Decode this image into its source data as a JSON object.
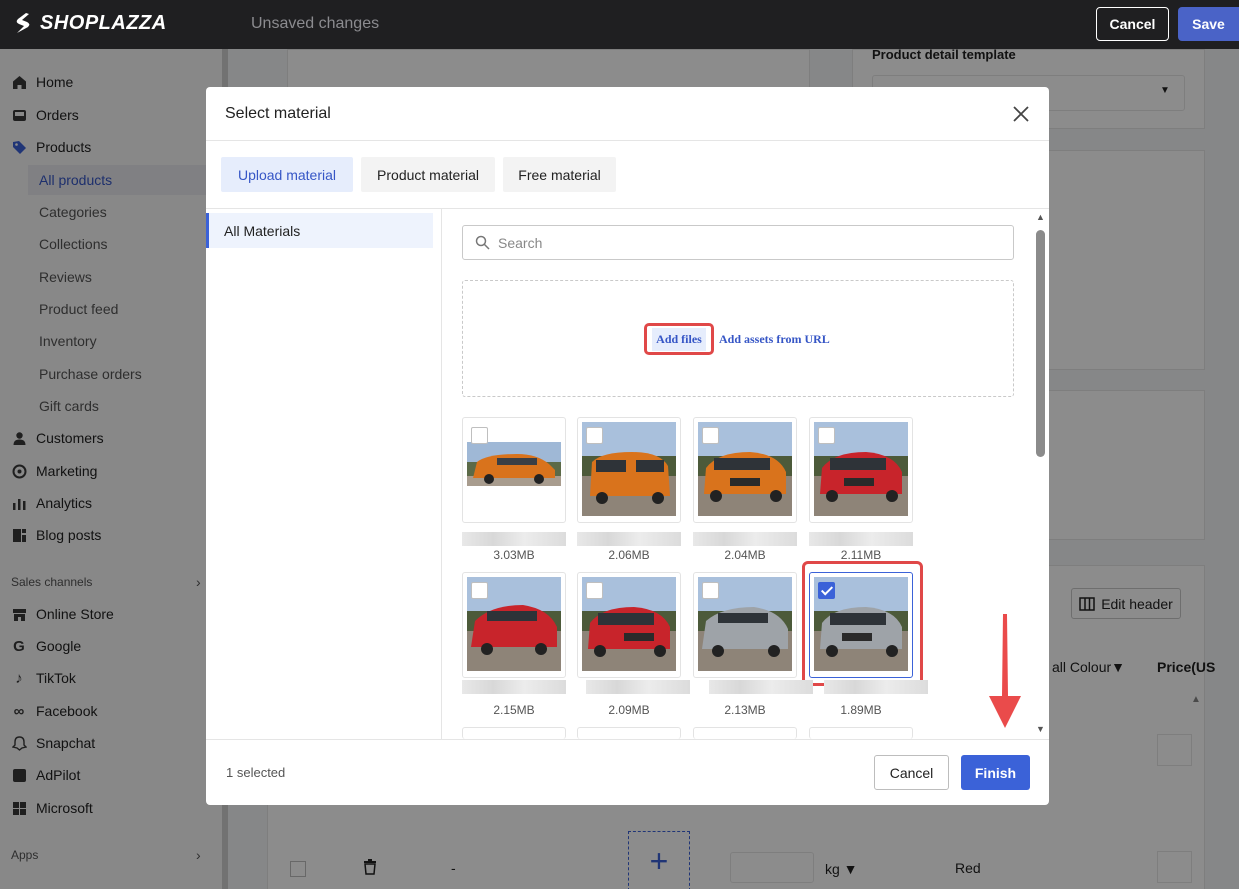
{
  "topbar": {
    "brand": "SHOPLAZZA",
    "status": "Unsaved changes",
    "cancel_label": "Cancel",
    "save_label": "Save"
  },
  "sidebar": {
    "items": [
      {
        "label": "Home",
        "icon": "home-icon"
      },
      {
        "label": "Orders",
        "icon": "inbox-icon"
      },
      {
        "label": "Products",
        "icon": "tag-icon"
      }
    ],
    "product_subitems": [
      "All products",
      "Categories",
      "Collections",
      "Reviews",
      "Product feed",
      "Inventory",
      "Purchase orders",
      "Gift cards"
    ],
    "more_items": [
      {
        "label": "Customers",
        "icon": "person-icon"
      },
      {
        "label": "Marketing",
        "icon": "target-icon"
      },
      {
        "label": "Analytics",
        "icon": "bar-chart-icon"
      },
      {
        "label": "Blog posts",
        "icon": "blog-icon"
      }
    ],
    "sales_channels_label": "Sales channels",
    "channels": [
      {
        "label": "Online Store",
        "icon": "store-icon"
      },
      {
        "label": "Google",
        "icon": "google-icon"
      },
      {
        "label": "TikTok",
        "icon": "tiktok-icon"
      },
      {
        "label": "Facebook",
        "icon": "meta-icon"
      },
      {
        "label": "Snapchat",
        "icon": "ghost-icon"
      },
      {
        "label": "AdPilot",
        "icon": "adpilot-icon"
      },
      {
        "label": "Microsoft",
        "icon": "microsoft-icon"
      }
    ],
    "apps_label": "Apps"
  },
  "background": {
    "template_label": "Product detail template",
    "edit_header_label": "Edit header",
    "colour_col": "all Colour",
    "price_col": "Price(US",
    "unit": "kg",
    "dash": "-",
    "variant_value": "Red"
  },
  "modal": {
    "title": "Select material",
    "tabs": [
      {
        "label": "Upload material",
        "active": true
      },
      {
        "label": "Product material",
        "active": false
      },
      {
        "label": "Free material",
        "active": false
      }
    ],
    "folders": [
      "All Materials"
    ],
    "search_placeholder": "Search",
    "add_files_label": "Add files",
    "add_url_label": "Add assets from URL",
    "materials": [
      {
        "size": "3.03MB",
        "color": "orange",
        "checked": false
      },
      {
        "size": "2.06MB",
        "color": "orange",
        "checked": false
      },
      {
        "size": "2.04MB",
        "color": "orange",
        "checked": false
      },
      {
        "size": "2.11MB",
        "color": "red",
        "checked": false
      },
      {
        "size": "2.15MB",
        "color": "red",
        "checked": false
      },
      {
        "size": "2.09MB",
        "color": "red",
        "checked": false
      },
      {
        "size": "2.13MB",
        "color": "silver",
        "checked": false
      },
      {
        "size": "1.89MB",
        "color": "silver",
        "checked": true
      }
    ],
    "selected_count": "1 selected",
    "cancel_label": "Cancel",
    "finish_label": "Finish"
  },
  "colors": {
    "accent": "#3b62d8",
    "highlight": "#e04848",
    "car_orange": "#d9731c",
    "car_red": "#c8242b",
    "car_silver": "#9ea3a8"
  }
}
